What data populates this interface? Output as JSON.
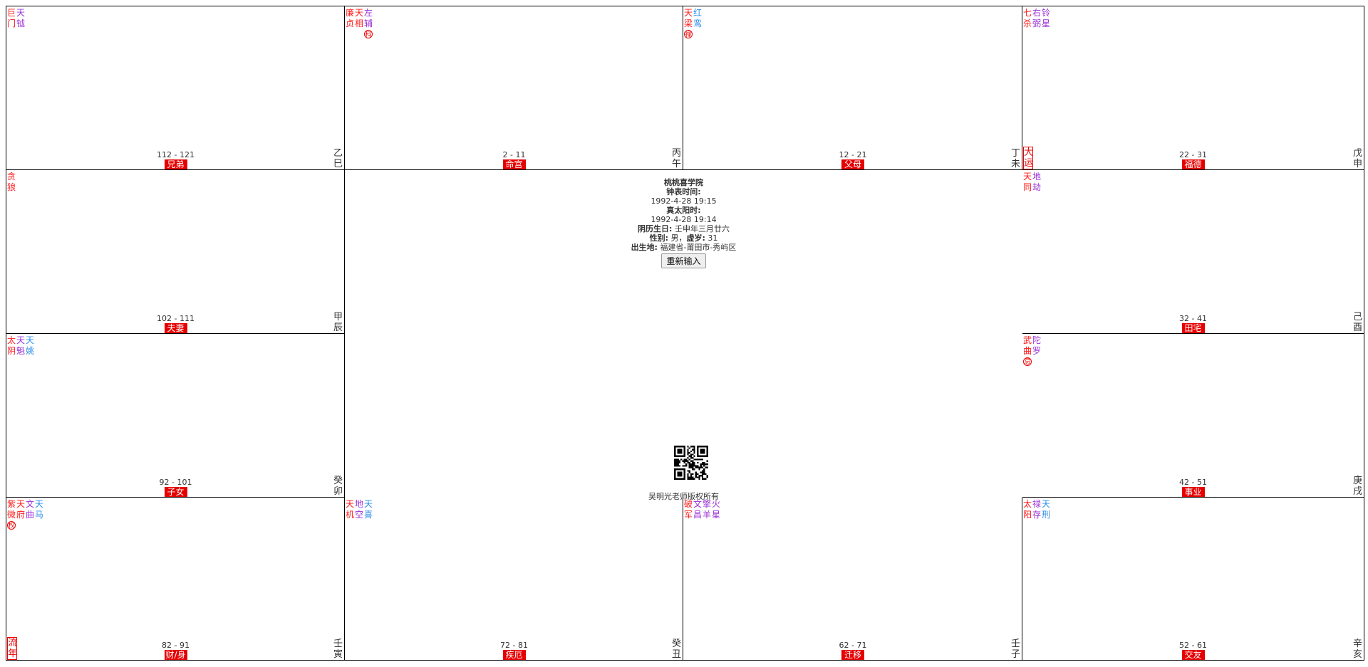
{
  "palaces": [
    {
      "stars": [
        {
          "ch": [
            "巨",
            "门"
          ],
          "color": "red"
        },
        {
          "ch": [
            "天",
            "钺"
          ],
          "color": "purple"
        }
      ],
      "ages": "112 - 121",
      "name": "兄弟",
      "branch": [
        "乙",
        "巳"
      ]
    },
    {
      "stars": [
        {
          "ch": [
            "廉",
            "贞"
          ],
          "color": "red"
        },
        {
          "ch": [
            "天",
            "相"
          ],
          "color": "red"
        },
        {
          "ch": [
            "左",
            "辅"
          ],
          "color": "purple",
          "hua": "科"
        }
      ],
      "ages": "2 - 11",
      "name": "命宫",
      "branch": [
        "丙",
        "午"
      ]
    },
    {
      "stars": [
        {
          "ch": [
            "天",
            "梁"
          ],
          "color": "red",
          "hua": "禄"
        },
        {
          "ch": [
            "红",
            "鸾"
          ],
          "color": "blue"
        }
      ],
      "ages": "12 - 21",
      "name": "父母",
      "branch": [
        "丁",
        "未"
      ]
    },
    {
      "stars": [
        {
          "ch": [
            "七",
            "杀"
          ],
          "color": "red"
        },
        {
          "ch": [
            "右",
            "弼"
          ],
          "color": "purple"
        },
        {
          "ch": [
            "铃",
            "星"
          ],
          "color": "purple"
        }
      ],
      "ages": "22 - 31",
      "name": "福德",
      "branch": [
        "戊",
        "申"
      ],
      "marker": [
        "大",
        "运"
      ]
    },
    {
      "stars": [
        {
          "ch": [
            "贪",
            "狼"
          ],
          "color": "red"
        }
      ],
      "ages": "102 - 111",
      "name": "夫妻",
      "branch": [
        "甲",
        "辰"
      ]
    },
    {
      "stars": [
        {
          "ch": [
            "天",
            "同"
          ],
          "color": "red"
        },
        {
          "ch": [
            "地",
            "劫"
          ],
          "color": "purple"
        }
      ],
      "ages": "32 - 41",
      "name": "田宅",
      "branch": [
        "己",
        "酉"
      ]
    },
    {
      "stars": [
        {
          "ch": [
            "太",
            "阴"
          ],
          "color": "red"
        },
        {
          "ch": [
            "天",
            "魁"
          ],
          "color": "purple"
        },
        {
          "ch": [
            "天",
            "姚"
          ],
          "color": "blue"
        }
      ],
      "ages": "92 - 101",
      "name": "子女",
      "branch": [
        "癸",
        "卯"
      ]
    },
    {
      "stars": [
        {
          "ch": [
            "武",
            "曲"
          ],
          "color": "red",
          "hua": "忌"
        },
        {
          "ch": [
            "陀",
            "罗"
          ],
          "color": "purple"
        }
      ],
      "ages": "42 - 51",
      "name": "事业",
      "branch": [
        "庚",
        "戌"
      ]
    },
    {
      "stars": [
        {
          "ch": [
            "紫",
            "微"
          ],
          "color": "red",
          "hua": "权"
        },
        {
          "ch": [
            "天",
            "府"
          ],
          "color": "red"
        },
        {
          "ch": [
            "文",
            "曲"
          ],
          "color": "purple"
        },
        {
          "ch": [
            "天",
            "马"
          ],
          "color": "blue"
        }
      ],
      "ages": "82 - 91",
      "name": "财/身",
      "branch": [
        "壬",
        "寅"
      ],
      "marker": [
        "流",
        "年"
      ]
    },
    {
      "stars": [
        {
          "ch": [
            "天",
            "机"
          ],
          "color": "red"
        },
        {
          "ch": [
            "地",
            "空"
          ],
          "color": "purple"
        },
        {
          "ch": [
            "天",
            "喜"
          ],
          "color": "blue"
        }
      ],
      "ages": "72 - 81",
      "name": "疾厄",
      "branch": [
        "癸",
        "丑"
      ]
    },
    {
      "stars": [
        {
          "ch": [
            "破",
            "军"
          ],
          "color": "red"
        },
        {
          "ch": [
            "文",
            "昌"
          ],
          "color": "purple"
        },
        {
          "ch": [
            "擎",
            "羊"
          ],
          "color": "purple"
        },
        {
          "ch": [
            "火",
            "星"
          ],
          "color": "purple"
        }
      ],
      "ages": "62 - 71",
      "name": "迁移",
      "branch": [
        "壬",
        "子"
      ]
    },
    {
      "stars": [
        {
          "ch": [
            "太",
            "阳"
          ],
          "color": "red"
        },
        {
          "ch": [
            "禄",
            "存"
          ],
          "color": "purple"
        },
        {
          "ch": [
            "天",
            "刑"
          ],
          "color": "blue"
        }
      ],
      "ages": "52 - 61",
      "name": "交友",
      "branch": [
        "辛",
        "亥"
      ]
    }
  ],
  "center": {
    "school": "桃桃喜学院",
    "clock_label": "钟表时间:",
    "clock_value": "1992-4-28 19:15",
    "solar_label": "真太阳时:",
    "solar_value": "1992-4-28 19:14",
    "lunar_label": "阴历生日:",
    "lunar_value": "壬申年三月廿六",
    "gender_label": "性别:",
    "gender_value": "男",
    "age_label": "虚岁:",
    "age_value": "31",
    "place_label": "出生地:",
    "place_value": "福建省-莆田市-秀屿区",
    "reenter_button": "重新输入",
    "copyright": "吴明光老师版权所有"
  }
}
